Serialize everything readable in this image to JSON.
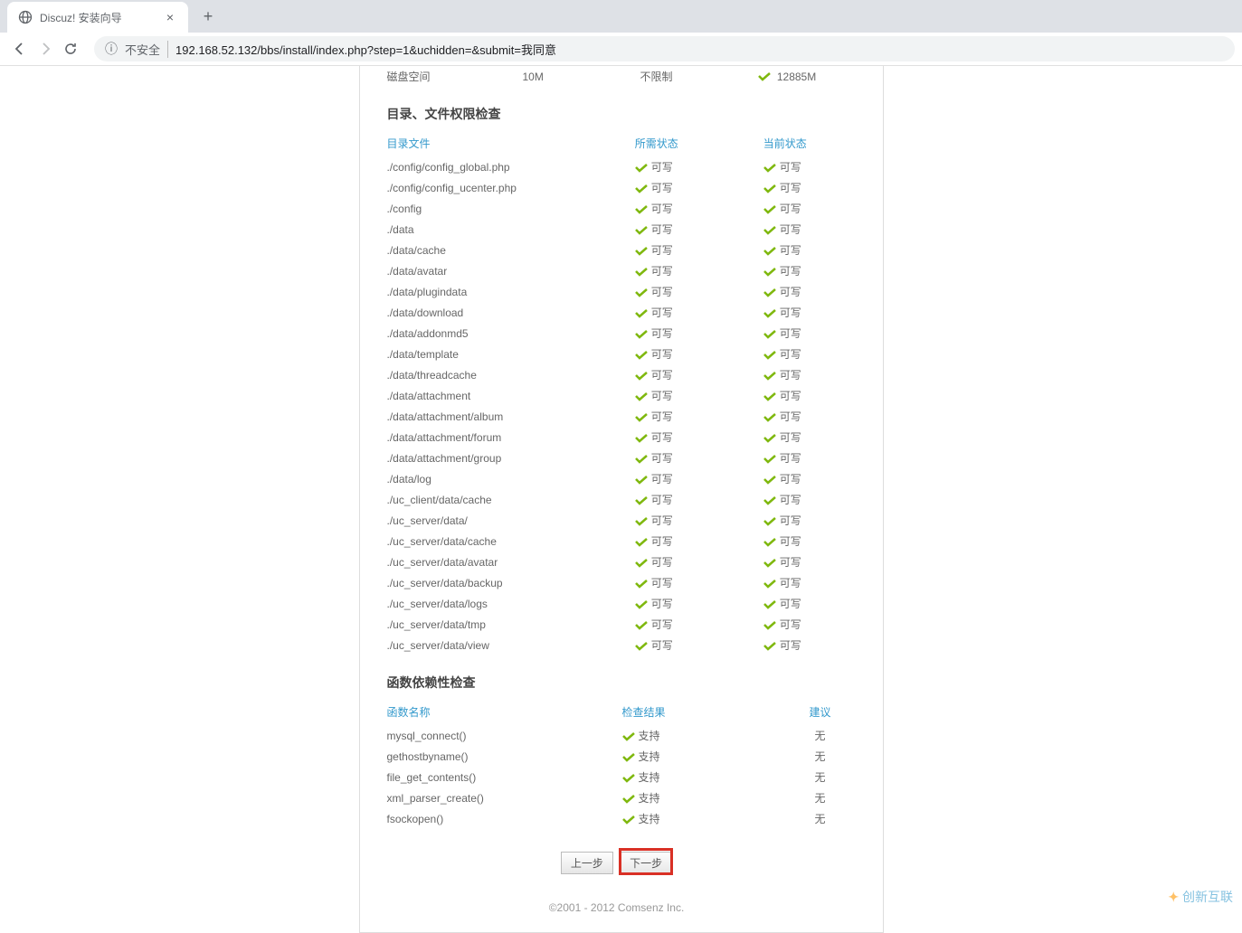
{
  "browser": {
    "tab_title": "Discuz! 安装向导",
    "security_label": "不安全",
    "url": "192.168.52.132/bbs/install/index.php?step=1&uchidden=&submit=我同意"
  },
  "partial_row": {
    "label": "磁盘空间",
    "min": "10M",
    "limit": "不限制",
    "current": "12885M"
  },
  "perm_section": {
    "title": "目录、文件权限检查",
    "col_name": "目录文件",
    "col_required": "所需状态",
    "col_current": "当前状态",
    "writable": "可写",
    "rows": [
      "./config/config_global.php",
      "./config/config_ucenter.php",
      "./config",
      "./data",
      "./data/cache",
      "./data/avatar",
      "./data/plugindata",
      "./data/download",
      "./data/addonmd5",
      "./data/template",
      "./data/threadcache",
      "./data/attachment",
      "./data/attachment/album",
      "./data/attachment/forum",
      "./data/attachment/group",
      "./data/log",
      "./uc_client/data/cache",
      "./uc_server/data/",
      "./uc_server/data/cache",
      "./uc_server/data/avatar",
      "./uc_server/data/backup",
      "./uc_server/data/logs",
      "./uc_server/data/tmp",
      "./uc_server/data/view"
    ]
  },
  "func_section": {
    "title": "函数依赖性检查",
    "col_name": "函数名称",
    "col_result": "检查结果",
    "col_suggest": "建议",
    "supported": "支持",
    "none": "无",
    "rows": [
      "mysql_connect()",
      "gethostbyname()",
      "file_get_contents()",
      "xml_parser_create()",
      "fsockopen()"
    ]
  },
  "buttons": {
    "prev": "上一步",
    "next": "下一步"
  },
  "footer": "©2001 - 2012 Comsenz Inc.",
  "watermark": {
    "name": "创新互联"
  }
}
